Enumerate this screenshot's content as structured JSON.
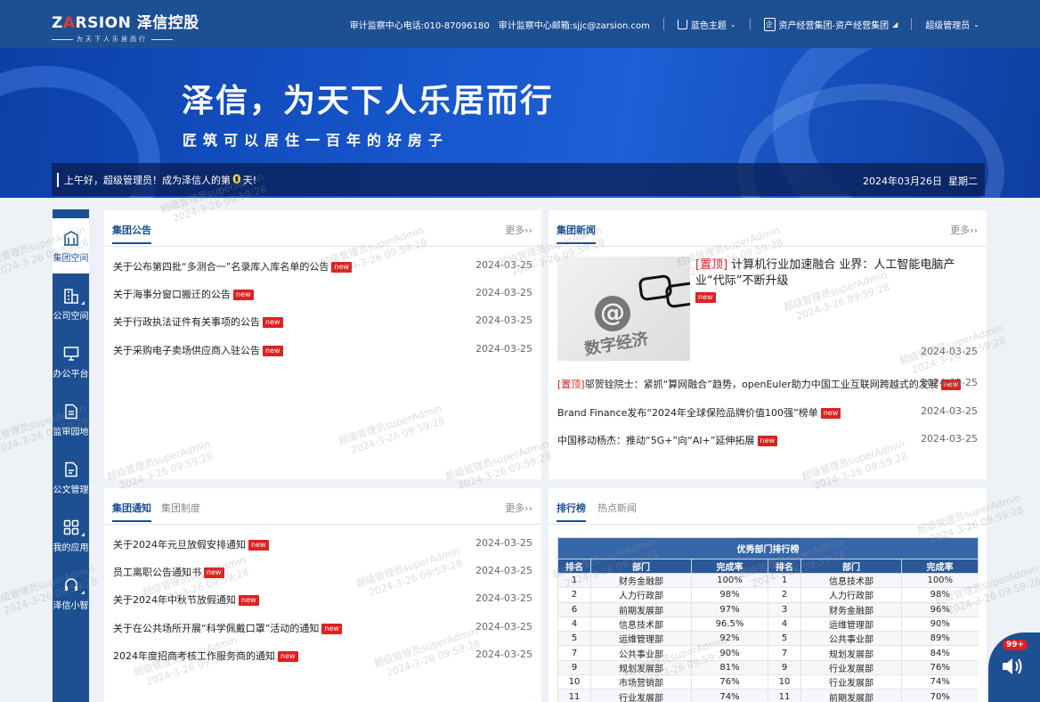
{
  "brand": {
    "name_latin_a": "Z",
    "name_latin_b": "A",
    "name_latin_c": "RSION",
    "name_cn": "泽信控股",
    "slogan": "为天下人乐居而行"
  },
  "header": {
    "phone": "审计监察中心电话:010-87096180",
    "email": "审计监察中心邮箱:sjjc@zarsion.com",
    "theme": "蓝色主题",
    "org": "资产经营集团-资产经营集团",
    "user": "超级管理员"
  },
  "banner": {
    "title": "泽信，为天下人乐居而行",
    "subtitle": "匠筑可以居住一百年的好房子",
    "greeting_pre": "上午好，超级管理员！成为泽信人的第",
    "greeting_days": "0",
    "greeting_post": "天!",
    "date": "2024年03月26日",
    "weekday": "星期二"
  },
  "sidebar": [
    {
      "label": "集团空间",
      "icon": "building-icon",
      "active": true
    },
    {
      "label": "公司空间",
      "icon": "office-icon"
    },
    {
      "label": "办公平台",
      "icon": "monitor-icon"
    },
    {
      "label": "监审园地",
      "icon": "document-icon"
    },
    {
      "label": "公文管理",
      "icon": "file-icon"
    },
    {
      "label": "我的应用",
      "icon": "apps-icon"
    },
    {
      "label": "泽信小智",
      "icon": "assistant-icon"
    }
  ],
  "announcements": {
    "tab": "集团公告",
    "more": "更多››",
    "items": [
      {
        "title": "关于公布第四批“多测合一”名录库入库名单的公告",
        "date": "2024-03-25",
        "new": "new"
      },
      {
        "title": "关于海事分窗口搬迁的公告",
        "date": "2024-03-25",
        "new": "new"
      },
      {
        "title": "关于行政执法证件有关事项的公告",
        "date": "2024-03-25",
        "new": "new"
      },
      {
        "title": "关于采购电子卖场供应商入驻公告",
        "date": "2024-03-25",
        "new": "new"
      }
    ]
  },
  "news": {
    "tab": "集团新闻",
    "more": "更多››",
    "image_caption": "数字经济",
    "top_tag": "[置顶]",
    "headline": "计算机行业加速融合 业界：人工智能电脑产业“代际”不断升级",
    "headline_new": "new",
    "headline_date": "2024-03-25",
    "items": [
      {
        "tag": "[置顶]",
        "title": "邬贺铨院士：紧抓“算网融合”趋势，openEuler助力中国工业互联网跨越式的发展",
        "date": "2024-03-25",
        "new": "new"
      },
      {
        "tag": "",
        "title": "Brand Finance发布“2024年全球保险品牌价值100强”榜单",
        "date": "2024-03-25",
        "new": "new"
      },
      {
        "tag": "",
        "title": "中国移动杨杰：推动“5G+”向“AI+”延伸拓展",
        "date": "2024-03-25",
        "new": "new"
      }
    ]
  },
  "notices": {
    "tab1": "集团通知",
    "tab2": "集团制度",
    "more": "更多››",
    "items": [
      {
        "title": "关于2024年元旦放假安排通知",
        "date": "2024-03-25",
        "new": "new"
      },
      {
        "title": "员工离职公告通知书",
        "date": "2024-03-25",
        "new": "new"
      },
      {
        "title": "关于2024年中秋节放假通知",
        "date": "2024-03-25",
        "new": "new"
      },
      {
        "title": "关于在公共场所开展“科学佩戴口罩”活动的通知",
        "date": "2024-03-25",
        "new": "new"
      },
      {
        "title": "2024年度招商考核工作服务商的通知",
        "date": "2024-03-25",
        "new": "new"
      }
    ]
  },
  "ranking": {
    "tab1": "排行榜",
    "tab2": "热点新闻",
    "caption": "优秀部门排行榜",
    "headers": [
      "排名",
      "部门",
      "完成率",
      "排名",
      "部门",
      "完成率"
    ],
    "rows": [
      [
        "1",
        "财务金融部",
        "100%",
        "1",
        "信息技术部",
        "100%"
      ],
      [
        "2",
        "人力行政部",
        "98%",
        "2",
        "人力行政部",
        "98%"
      ],
      [
        "6",
        "前期发展部",
        "97%",
        "3",
        "财务金融部",
        "96%"
      ],
      [
        "4",
        "信息技术部",
        "96.5%",
        "4",
        "运维管理部",
        "90%"
      ],
      [
        "5",
        "运维管理部",
        "92%",
        "5",
        "公共事业部",
        "89%"
      ],
      [
        "7",
        "公共事业部",
        "90%",
        "7",
        "规划发展部",
        "84%"
      ],
      [
        "9",
        "规划发展部",
        "81%",
        "9",
        "行业发展部",
        "76%"
      ],
      [
        "10",
        "市场营销部",
        "76%",
        "10",
        "行业发展部",
        "74%"
      ],
      [
        "11",
        "行业发展部",
        "74%",
        "11",
        "前期发展部",
        "70%"
      ]
    ]
  },
  "watermark": {
    "user": "超级管理员superAdmin",
    "time": "2024-3-26 09:59:28"
  },
  "float": {
    "badge": "99+"
  },
  "colors": {
    "primary": "#1d4f93",
    "new_badge": "#e02020",
    "days": "#ffd23a"
  }
}
